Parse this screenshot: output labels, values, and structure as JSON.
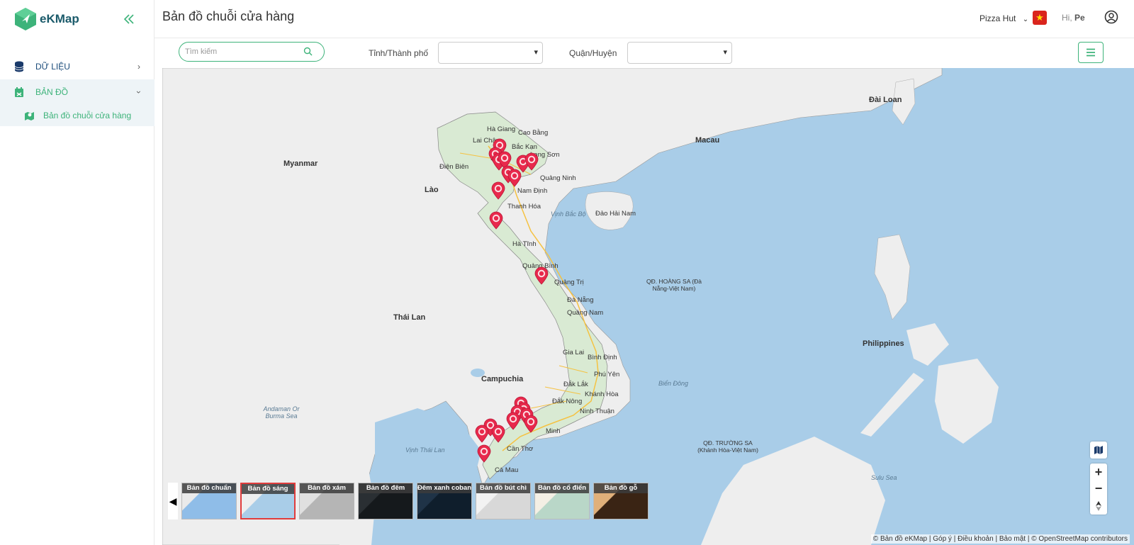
{
  "sidebar": {
    "logo_text": "eKMap",
    "items": [
      {
        "label": "DỮ LIỆU"
      },
      {
        "label": "BẢN ĐỒ"
      }
    ],
    "sub_items": [
      {
        "label": "Bản đồ chuỗi cửa hàng"
      }
    ]
  },
  "header": {
    "title": "Bản đồ chuỗi cửa hàng",
    "brand": "Pizza Hut",
    "greeting": "Hi,",
    "user_name": "Pe"
  },
  "filters": {
    "search_placeholder": "Tìm kiếm",
    "province_label": "Tỉnh/Thành phố",
    "district_label": "Quận/Huyện"
  },
  "map": {
    "countries": [
      "Myanmar",
      "Lào",
      "Thái Lan",
      "Campuchia",
      "Philippines",
      "Đài Loan",
      "Macau"
    ],
    "seas": [
      "Vịnh Bắc Bộ",
      "Biển Đông",
      "Vịnh Thái Lan",
      "Andaman Or Burma Sea",
      "Sulu Sea"
    ],
    "islands": [
      "Đảo Hải Nam",
      "QĐ. HOÀNG SA (Đà Nẵng-Việt Nam)",
      "QĐ. TRƯỜNG SA (Khánh Hòa-Việt Nam)"
    ],
    "provinces": [
      "Hà Giang",
      "Cao Bằng",
      "Lai Châu",
      "Bắc Kạn",
      "Lạng Sơn",
      "Yên",
      "Điện Biên",
      "Quảng Ninh",
      "Nam Định",
      "Thanh Hóa",
      "Hà Tĩnh",
      "Quảng Bình",
      "Quảng Trị",
      "Đà Nẵng",
      "Quảng Nam",
      "Gia Lai",
      "Bình Định",
      "Phú Yên",
      "Đắk Lắk",
      "Khánh Hòa",
      "Đắk Nông",
      "Ninh Thuận",
      "Cần Thơ",
      "Cà Mau",
      "Minh"
    ],
    "base_layers": [
      "Bản đồ chuẩn",
      "Bản đồ sáng",
      "Bản đồ xám",
      "Bản đồ đêm",
      "Đêm xanh coban",
      "Bản đồ bút chì",
      "Bản đồ cổ điển",
      "Bản đồ gỗ"
    ],
    "selected_layer": "Bản đồ sáng",
    "attribution": "© Bản đồ eKMap | Góp ý | Điều khoản | Bảo mật | © OpenStreetMap contributors"
  },
  "colors": {
    "accent": "#3db37a",
    "pin": "#e8294c",
    "water": "#a9cde8",
    "land": "#eeeeee",
    "vietnam": "#d9ead3"
  }
}
